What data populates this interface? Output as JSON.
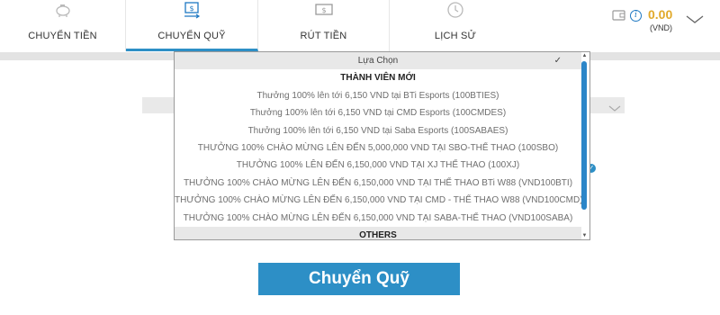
{
  "nav": {
    "tabs": [
      {
        "label": "CHUYỂN TIỀN",
        "icon": "piggy-bank-icon",
        "active": false
      },
      {
        "label": "CHUYỂN QUỸ",
        "icon": "money-transfer-icon",
        "active": true
      },
      {
        "label": "RÚT TIỀN",
        "icon": "cash-bill-icon",
        "active": false
      },
      {
        "label": "LỊCH SỬ",
        "icon": "history-clock-icon",
        "active": false
      }
    ]
  },
  "wallet": {
    "balance": "0.00",
    "currency": "(VND)",
    "info_symbol": "i",
    "accent_color": "#e1a92a"
  },
  "dropdown": {
    "selected_label": "Lựa Chọn",
    "check_symbol": "✓",
    "groups": [
      {
        "label": "THÀNH VIÊN MỚI",
        "options": [
          "Thưởng 100% lên tới 6,150 VND tại BTi Esports (100BTIES)",
          "Thưởng 100% lên tới 6,150 VND tại CMD Esports (100CMDES)",
          "Thưởng 100% lên tới 6,150 VND tại Saba Esports (100SABAES)",
          "THƯỞNG 100% CHÀO MỪNG LÊN ĐẾN 5,000,000 VND TẠI SBO-THỂ THAO (100SBO)",
          "THƯỞNG 100% LÊN ĐẾN 6,150,000 VND TẠI XJ THỂ THAO (100XJ)",
          "THƯỞNG 100% CHÀO MỪNG LÊN ĐẾN 6,150,000 VND TẠI THỂ THAO BTi W88 (VND100BTI)",
          "THƯỞNG 100% CHÀO MỪNG LÊN ĐẾN 6,150,000 VND TẠI CMD - THỂ THAO W88 (VND100CMD)",
          "THƯỞNG 100% CHÀO MỪNG LÊN ĐẾN 6,150,000 VND TẠI SABA-THỂ THAO (VND100SABA)"
        ]
      },
      {
        "label": "OTHERS",
        "options": []
      }
    ]
  },
  "submit": {
    "label": "Chuyển Quỹ",
    "color": "#2d8fc6"
  }
}
